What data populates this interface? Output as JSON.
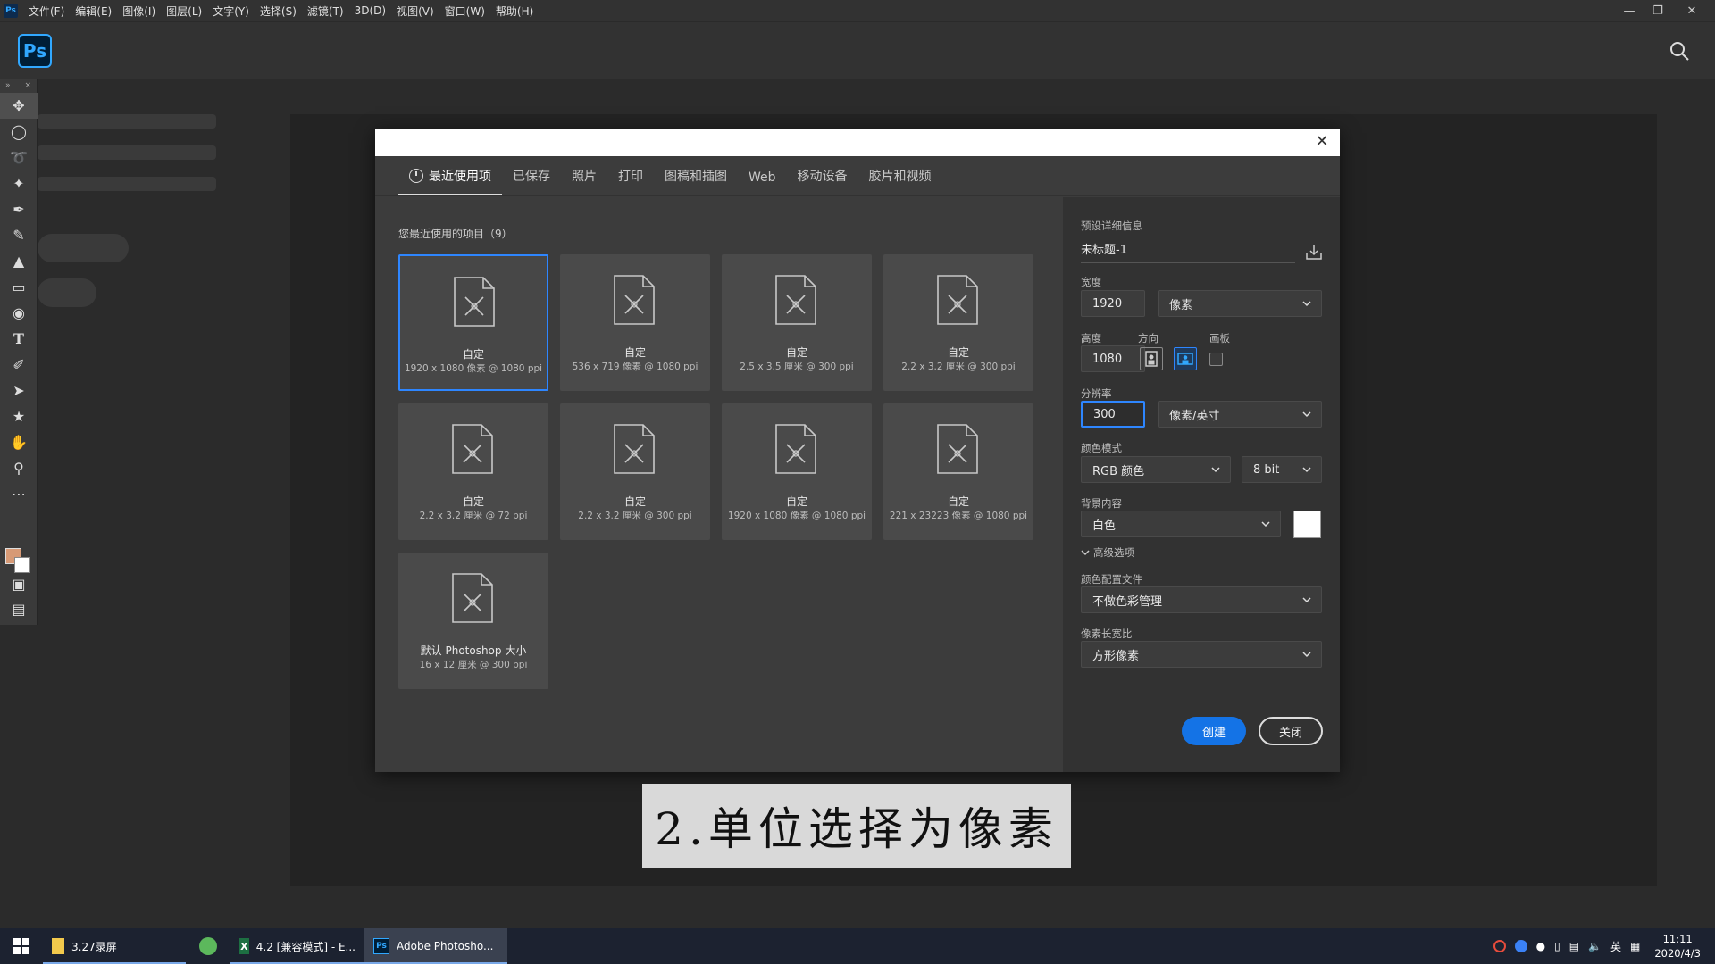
{
  "menubar": {
    "items": [
      "文件(F)",
      "编辑(E)",
      "图像(I)",
      "图层(L)",
      "文字(Y)",
      "选择(S)",
      "滤镜(T)",
      "3D(D)",
      "视图(V)",
      "窗口(W)",
      "帮助(H)"
    ]
  },
  "app": {
    "logo": "Ps"
  },
  "dialog": {
    "tabs": [
      "最近使用项",
      "已保存",
      "照片",
      "打印",
      "图稿和插图",
      "Web",
      "移动设备",
      "胶片和视频"
    ],
    "recent_title": "您最近使用的项目（9）",
    "presets": [
      {
        "name": "自定",
        "detail": "1920 x 1080 像素 @ 1080 ppi",
        "selected": true
      },
      {
        "name": "自定",
        "detail": "536 x 719 像素 @ 1080 ppi"
      },
      {
        "name": "自定",
        "detail": "2.5 x 3.5 厘米 @ 300 ppi"
      },
      {
        "name": "自定",
        "detail": "2.2 x 3.2 厘米 @ 300 ppi"
      },
      {
        "name": "自定",
        "detail": "2.2 x 3.2 厘米 @ 72 ppi"
      },
      {
        "name": "自定",
        "detail": "2.2 x 3.2 厘米 @ 300 ppi"
      },
      {
        "name": "自定",
        "detail": "1920 x 1080 像素 @ 1080 ppi"
      },
      {
        "name": "自定",
        "detail": "221 x 23223 像素 @ 1080 ppi"
      },
      {
        "name": "默认 Photoshop 大小",
        "detail": "16 x 12 厘米 @ 300 ppi"
      }
    ],
    "details": {
      "section_title": "预设详细信息",
      "doc_name": "未标题-1",
      "width_label": "宽度",
      "width_value": "1920",
      "width_unit": "像素",
      "height_label": "高度",
      "height_value": "1080",
      "orientation_label": "方向",
      "artboard_label": "画板",
      "resolution_label": "分辨率",
      "resolution_value": "300",
      "resolution_unit": "像素/英寸",
      "color_mode_label": "颜色模式",
      "color_mode": "RGB 颜色",
      "bit_depth": "8 bit",
      "background_label": "背景内容",
      "background": "白色",
      "advanced_label": "高级选项",
      "color_profile_label": "颜色配置文件",
      "color_profile": "不做色彩管理",
      "pixel_aspect_label": "像素长宽比",
      "pixel_aspect": "方形像素"
    },
    "buttons": {
      "create": "创建",
      "close": "关闭"
    }
  },
  "caption": "2.单位选择为像素",
  "taskbar": {
    "items": [
      {
        "label": "3.27录屏"
      },
      {
        "label": "4.2 [兼容模式] - E..."
      },
      {
        "label": "Adobe Photosho..."
      }
    ],
    "ime": "英",
    "time": "11:11",
    "date": "2020/4/3"
  }
}
